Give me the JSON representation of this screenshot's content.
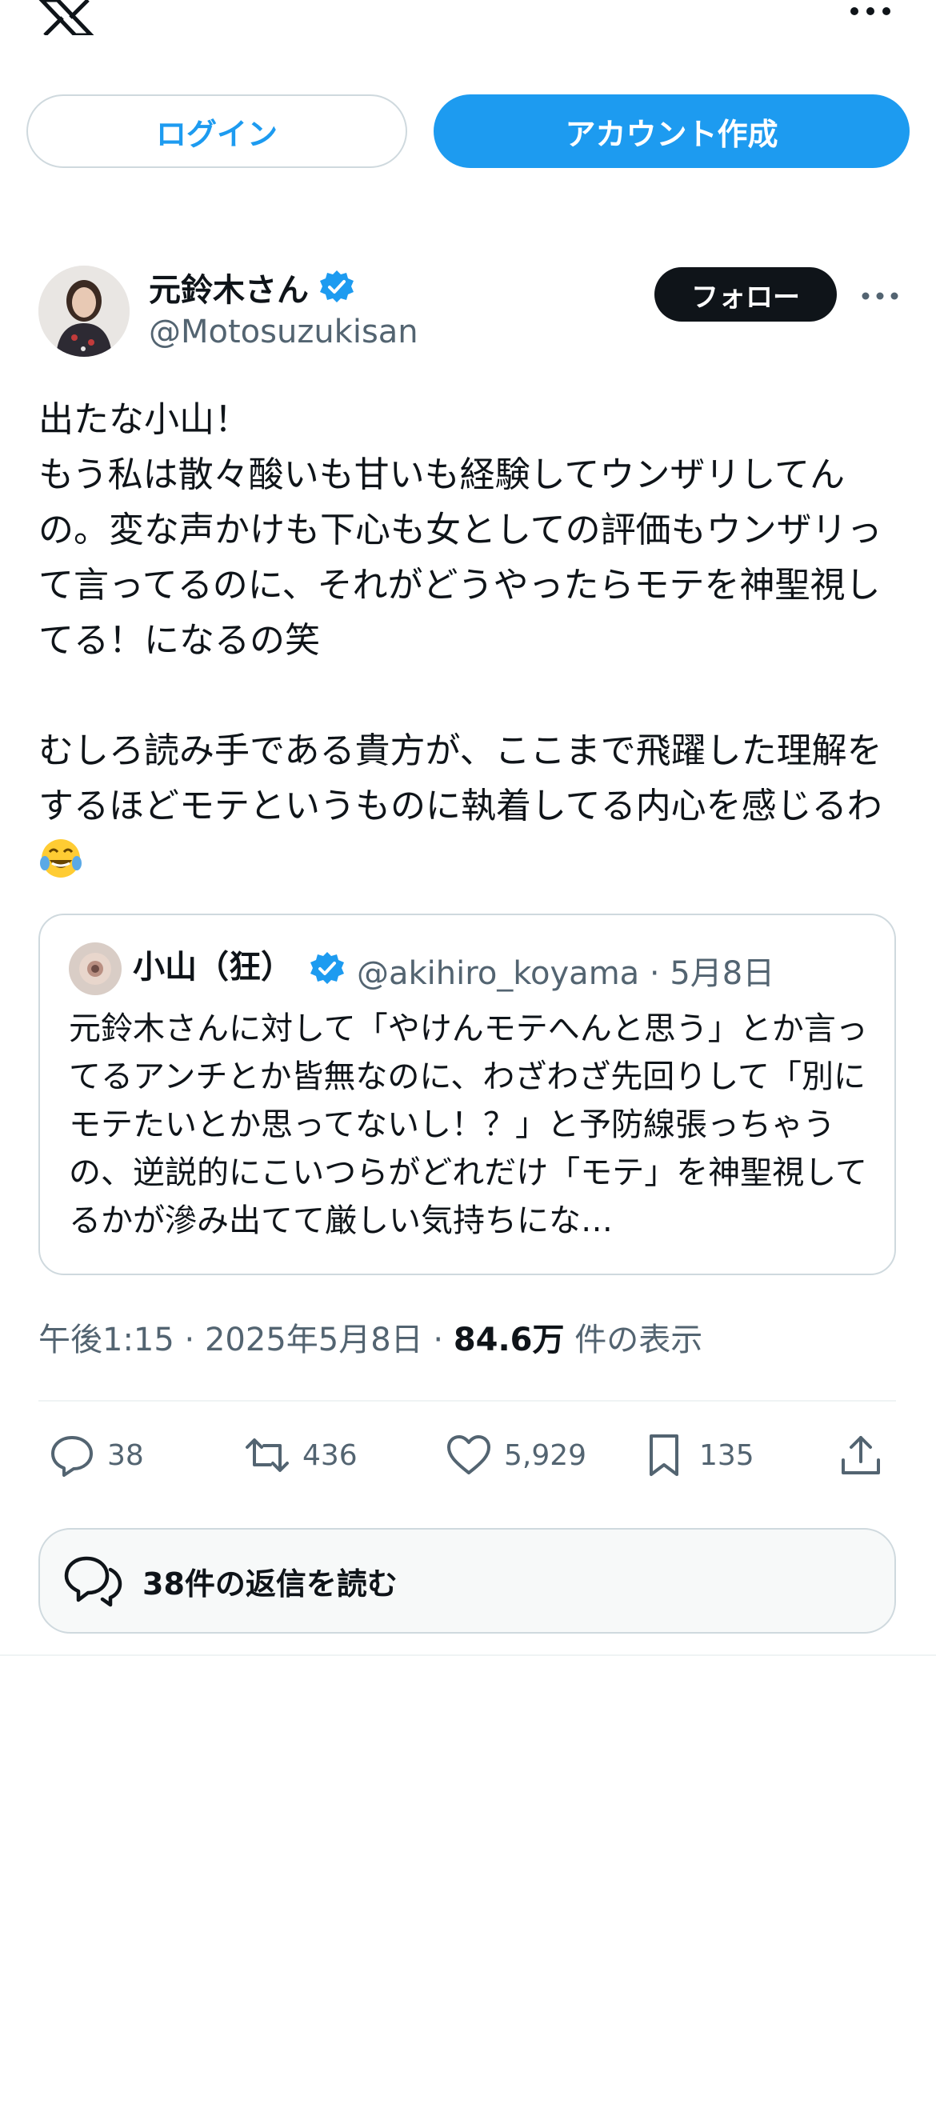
{
  "header": {
    "logo": "x-logo-icon",
    "more": "more-icon"
  },
  "auth": {
    "login_label": "ログイン",
    "signup_label": "アカウント作成"
  },
  "tweet": {
    "author_name": "元鈴木さん",
    "author_handle": "@Motosuzukisan",
    "follow_label": "フォロー",
    "text": "出たな小山！\nもう私は散々酸いも甘いも経験してウンザリしてんの。変な声かけも下心も女としての評価もウンザリって言ってるのに、それがどうやったらモテを神聖視してる！になるの笑\n\nむしろ読み手である貴方が、ここまで飛躍した理解をするほどモテというものに執着してる内心を感じるわ",
    "emoji": "😂",
    "quote": {
      "author_name": "小山（狂）",
      "author_handle": "@akihiro_koyama",
      "date": "· 5月8日",
      "text": "元鈴木さんに対して「やけんモテへんと思う」とか言ってるアンチとか皆無なのに、わざわざ先回りして「別にモテたいとか思ってないし！？」と予防線張っちゃうの、逆説的にこいつらがどれだけ「モテ」を神聖視してるかが滲み出てて厳しい気持ちにな…"
    },
    "time": "午後1:15 · 2025年5月8日 · ",
    "views": "84.6万",
    "views_suffix": " 件の表示",
    "stats": {
      "replies": "38",
      "reposts": "436",
      "likes": "5,929",
      "bookmarks": "135"
    },
    "read_replies_label": "38件の返信を読む"
  },
  "colors": {
    "accent": "#1d9bf0",
    "text": "#0f1419",
    "muted": "#536471",
    "border": "#cfd9de"
  }
}
